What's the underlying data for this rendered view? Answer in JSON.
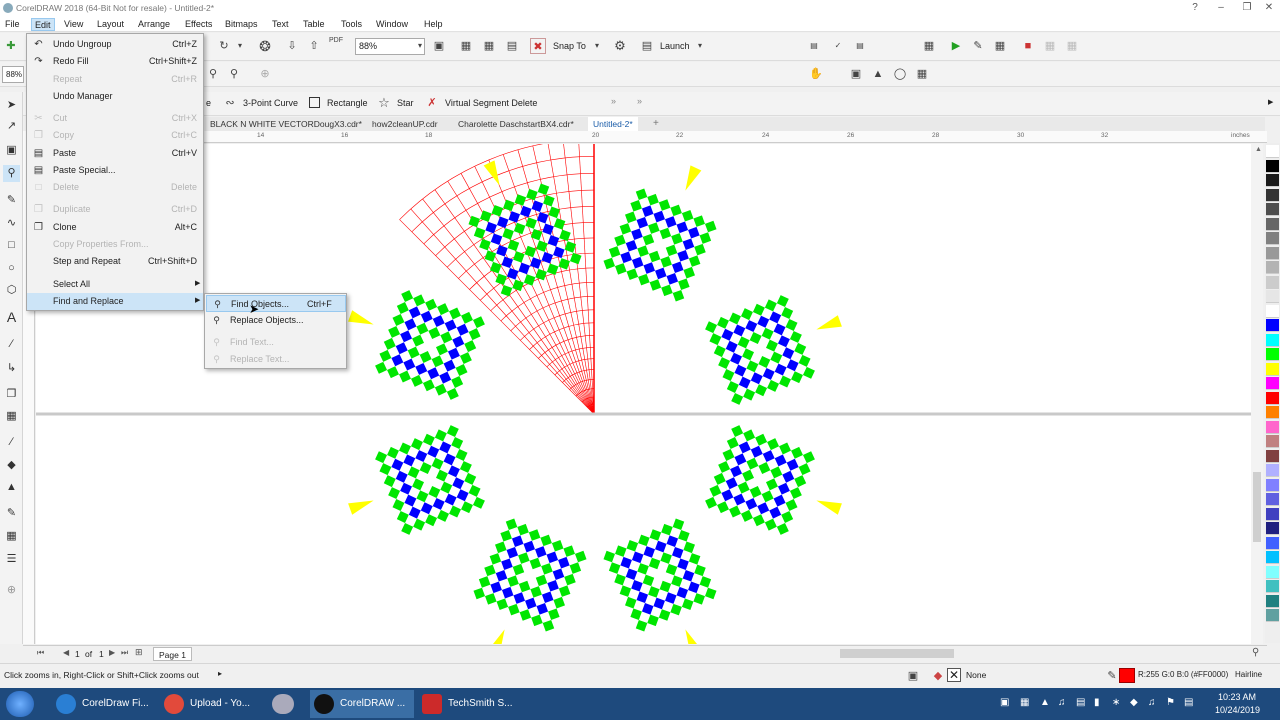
{
  "app": {
    "title": "CorelDRAW 2018 (64-Bit Not for resale) - Untitled-2*"
  },
  "menubar": {
    "items": [
      "File",
      "Edit",
      "View",
      "Layout",
      "Arrange",
      "Effects",
      "Bitmaps",
      "Text",
      "Table",
      "Tools",
      "Window",
      "Help"
    ]
  },
  "toolbar": {
    "zoom_value": "88%",
    "zoom_left": "88%",
    "snap_to": "Snap To",
    "launch": "Launch",
    "pdf": "PDF"
  },
  "propbar": {
    "item0": "e",
    "three_point_curve": "3-Point Curve",
    "rectangle": "Rectangle",
    "star": "Star",
    "virtual_segment_delete": "Virtual Segment Delete"
  },
  "tabs": [
    {
      "label": "BLACK N WHITE VECTORDougX3.cdr*",
      "active": false
    },
    {
      "label": "how2cleanUP.cdr",
      "active": false
    },
    {
      "label": "Charolette DaschstartBX4.cdr*",
      "active": false
    },
    {
      "label": "Untitled-2*",
      "active": true
    }
  ],
  "ruler": {
    "ticks": [
      "14",
      "16",
      "18",
      "20",
      "22",
      "24",
      "26",
      "28",
      "30",
      "32"
    ],
    "units": "inches"
  },
  "edit_menu": {
    "items": [
      {
        "label": "Undo Ungroup",
        "shortcut": "Ctrl+Z",
        "disabled": false,
        "icon": "undo-icon"
      },
      {
        "label": "Redo Fill",
        "shortcut": "Ctrl+Shift+Z",
        "disabled": false,
        "icon": "redo-icon"
      },
      {
        "label": "Repeat",
        "shortcut": "Ctrl+R",
        "disabled": true,
        "icon": ""
      },
      {
        "label": "Undo Manager",
        "shortcut": "",
        "disabled": false,
        "icon": ""
      },
      {
        "label": "Cut",
        "shortcut": "Ctrl+X",
        "disabled": true,
        "icon": "cut-icon"
      },
      {
        "label": "Copy",
        "shortcut": "Ctrl+C",
        "disabled": true,
        "icon": "copy-icon"
      },
      {
        "label": "Paste",
        "shortcut": "Ctrl+V",
        "disabled": false,
        "icon": "paste-icon"
      },
      {
        "label": "Paste Special...",
        "shortcut": "",
        "disabled": false,
        "icon": "paste-special-icon"
      },
      {
        "label": "Delete",
        "shortcut": "Delete",
        "disabled": true,
        "icon": "delete-icon"
      },
      {
        "label": "Duplicate",
        "shortcut": "Ctrl+D",
        "disabled": true,
        "icon": "duplicate-icon"
      },
      {
        "label": "Clone",
        "shortcut": "Alt+C",
        "disabled": false,
        "icon": "clone-icon"
      },
      {
        "label": "Copy Properties From...",
        "shortcut": "",
        "disabled": true,
        "icon": ""
      },
      {
        "label": "Step and Repeat",
        "shortcut": "Ctrl+Shift+D",
        "disabled": false,
        "icon": ""
      },
      {
        "label": "Select All",
        "shortcut": "",
        "disabled": false,
        "icon": "",
        "submenu": true
      },
      {
        "label": "Find and Replace",
        "shortcut": "",
        "disabled": false,
        "icon": "",
        "submenu": true,
        "highlighted": true
      }
    ]
  },
  "find_submenu": {
    "items": [
      {
        "label": "Find Objects...",
        "shortcut": "Ctrl+F",
        "disabled": false,
        "highlighted": true
      },
      {
        "label": "Replace Objects...",
        "shortcut": "",
        "disabled": false
      },
      {
        "label": "Find Text...",
        "shortcut": "",
        "disabled": true
      },
      {
        "label": "Replace Text...",
        "shortcut": "",
        "disabled": true
      }
    ]
  },
  "pagebar": {
    "page_current": "1",
    "of": "of",
    "page_total": "1",
    "page_tab": "Page 1"
  },
  "status": {
    "hint": "Click zooms in, Right-Click or Shift+Click zooms out",
    "fill_none": "None",
    "outline_color": "R:255 G:0 B:0 (#FF0000)",
    "outline_width": "Hairline"
  },
  "taskbar": {
    "items": [
      {
        "label": "CorelDraw Fi...",
        "active": false,
        "color": "#2a7fd4"
      },
      {
        "label": "Upload - Yo...",
        "active": false,
        "color": "#e24a3b"
      },
      {
        "label": "CorelDRAW ...",
        "active": true,
        "color": "#111111"
      },
      {
        "label": "TechSmith S...",
        "active": false,
        "color": "#cc2a2a"
      }
    ],
    "time": "10:23 AM",
    "date": "10/24/2019"
  },
  "palette": [
    "#ffffff",
    "#000000",
    "#1a1a1a",
    "#333333",
    "#4d4d4d",
    "#666666",
    "#808080",
    "#999999",
    "#b3b3b3",
    "#cccccc",
    "#e6e6e6",
    "#ffffff",
    "#0000ff",
    "#00ffff",
    "#00ff00",
    "#ffff00",
    "#ff00ff",
    "#ff0000",
    "#ff8000",
    "#ff66cc",
    "#c08080",
    "#804040",
    "#b0b0ff",
    "#8080ff",
    "#6060e0",
    "#4040c0",
    "#202080",
    "#4060ff",
    "#00c0ff",
    "#80ffff",
    "#40c0c0",
    "#208080",
    "#60a0a0"
  ],
  "colors": {
    "red": "#ff0000",
    "blue": "#0000ff",
    "green": "#00e600",
    "yellow": "#ffff00",
    "accent": "#1a5ca8"
  }
}
